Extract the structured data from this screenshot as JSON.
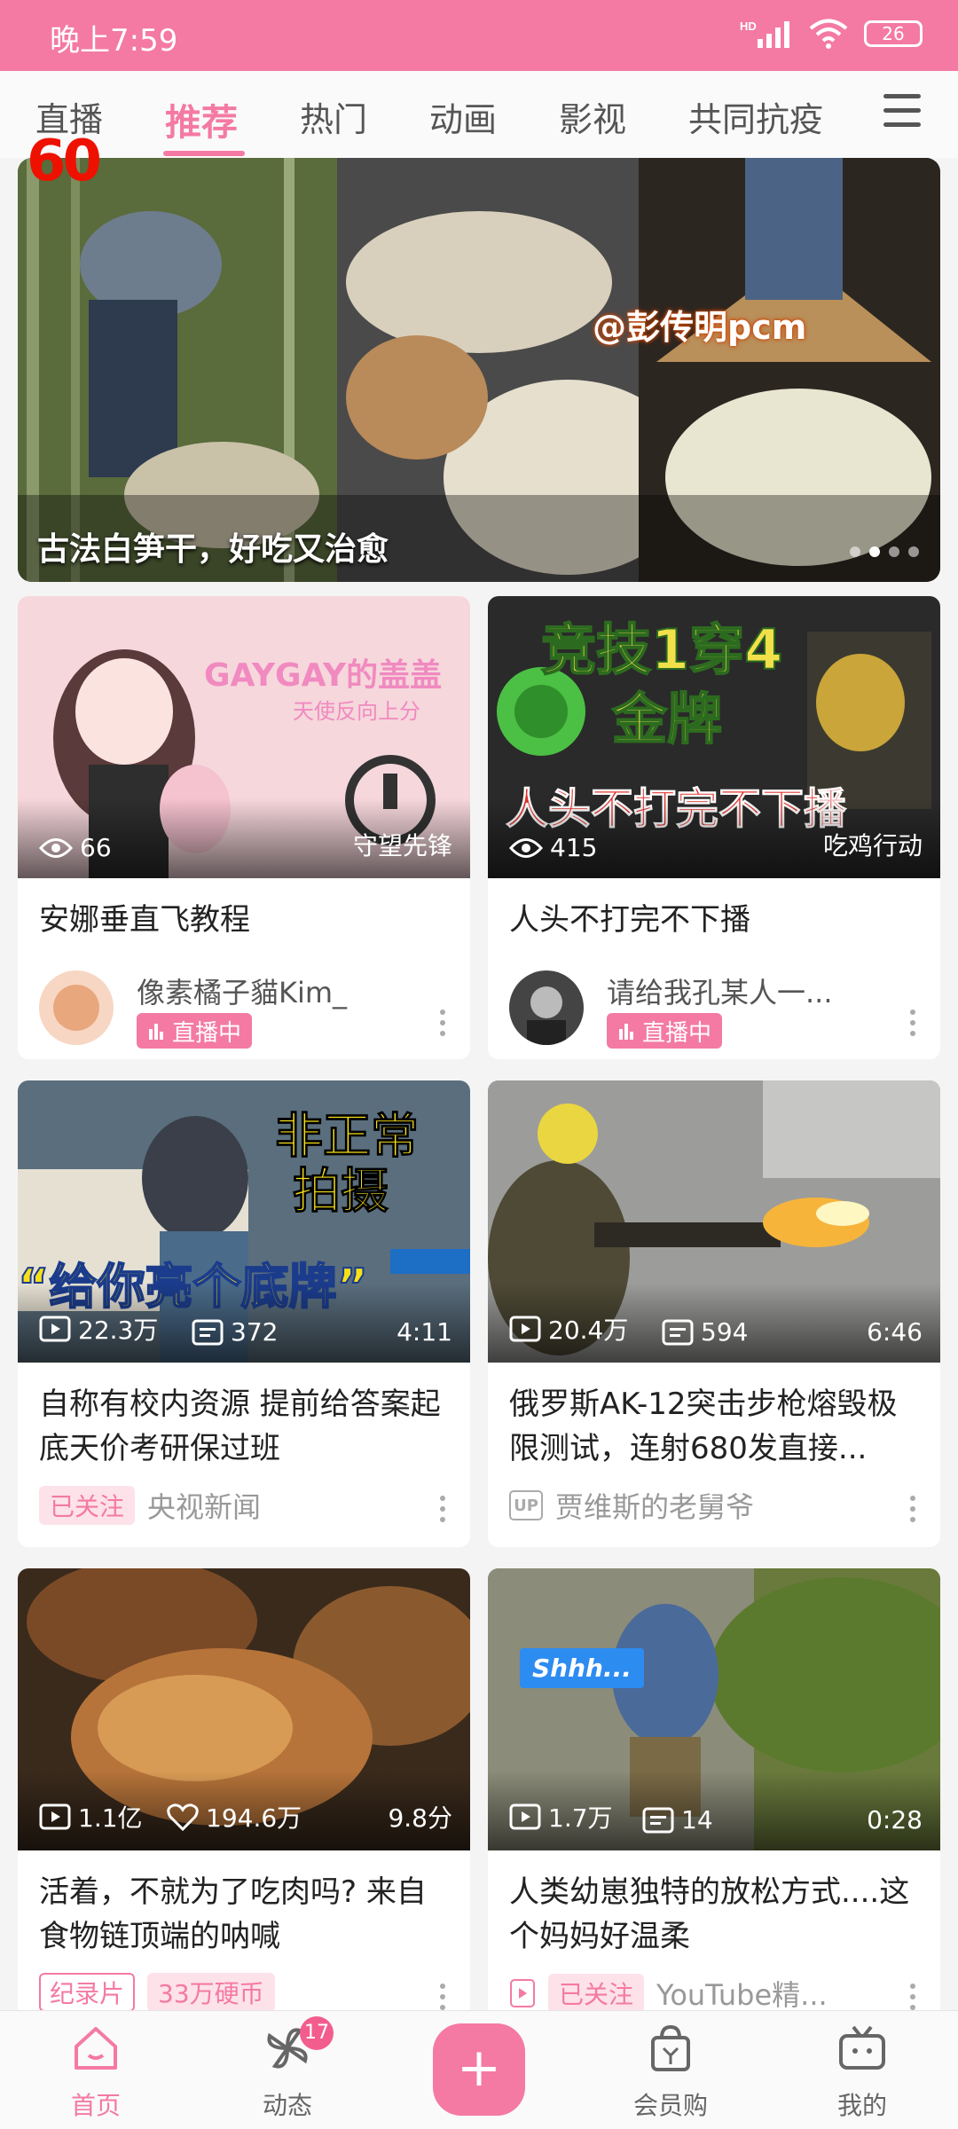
{
  "status_bar": {
    "time": "晚上7:59",
    "battery": "26",
    "signal_label": "HD"
  },
  "tabs": [
    "直播",
    "推荐",
    "热门",
    "动画",
    "影视",
    "共同抗疫"
  ],
  "active_tab": "推荐",
  "fps_overlay": "60",
  "banner": {
    "title": "古法白笋干，好吃又治愈",
    "watermark": "@彭传明pcm",
    "page_count": 4,
    "current_page": 2
  },
  "cards": [
    {
      "thumb_text": "GAYGAY的盖盖",
      "thumb_sub": "天使反向上分",
      "views": "66",
      "category": "守望先锋",
      "title": "安娜垂直飞教程",
      "uploader": "像素橘子貓Kim_",
      "badge": "直播中"
    },
    {
      "thumb_text": "竞技1穿4",
      "thumb_text2": "金牌",
      "thumb_sub": "人头不打完不下播",
      "views": "415",
      "category": "吃鸡行动",
      "title": "人头不打完不下播",
      "uploader": "请给我孔某人一...",
      "badge": "直播中"
    },
    {
      "thumb_text": "非正常",
      "thumb_text2": "拍摄",
      "thumb_sub": "“给你亮个底牌”",
      "views": "22.3万",
      "danmaku": "372",
      "duration": "4:11",
      "title": "自称有校内资源 提前给答案起底天价考研保过班",
      "follow_badge": "已关注",
      "uploader": "央视新闻"
    },
    {
      "views": "20.4万",
      "danmaku": "594",
      "duration": "6:46",
      "title": "俄罗斯AK-12突击步枪熔毁极限测试，连射680发直接...",
      "up_label": "UP",
      "uploader": "贾维斯的老舅爷"
    },
    {
      "views": "1.1亿",
      "likes": "194.6万",
      "score": "9.8分",
      "title": "活着，不就为了吃肉吗? 来自食物链顶端的呐喊",
      "tag1": "纪录片",
      "tag2": "33万硬币"
    },
    {
      "thumb_text": "Shhh...",
      "views": "1.7万",
      "danmaku": "14",
      "duration": "0:28",
      "title": "人类幼崽独特的放松方式....这个妈妈好温柔",
      "follow_badge": "已关注",
      "uploader": "YouTube精..."
    }
  ],
  "bottom_nav": {
    "home": "首页",
    "dynamic": "动态",
    "dynamic_badge": "17",
    "shop": "会员购",
    "mine": "我的",
    "plus": "+"
  },
  "colors": {
    "accent": "#f47aa3",
    "status_bar": "#f47aa3"
  }
}
